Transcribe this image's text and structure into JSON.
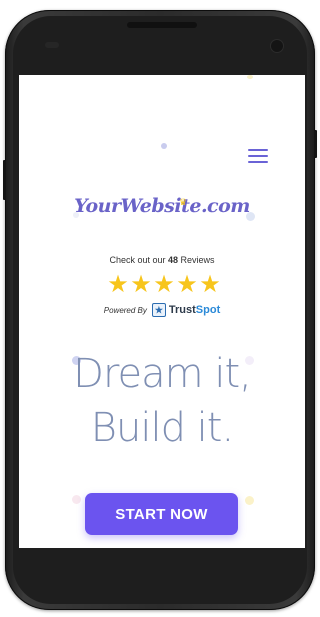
{
  "site": {
    "logo_text": "YourWebsite.com"
  },
  "menu": {
    "icon": "hamburger-menu-icon"
  },
  "reviews": {
    "prefix": "Check out our ",
    "count": "48",
    "suffix": " Reviews",
    "rating_stars": 5,
    "powered_by": "Powered By",
    "provider_part1": "Trust",
    "provider_part2": "Spot"
  },
  "hero": {
    "line1": "Dream it,",
    "line2": "Build it."
  },
  "cta": {
    "label": "START NOW"
  },
  "colors": {
    "accent": "#6b54ef",
    "logo": "#6a63c8",
    "headline": "#7f8fb3",
    "star": "#f7c51c",
    "phone_frame": "#2b2b2b"
  }
}
